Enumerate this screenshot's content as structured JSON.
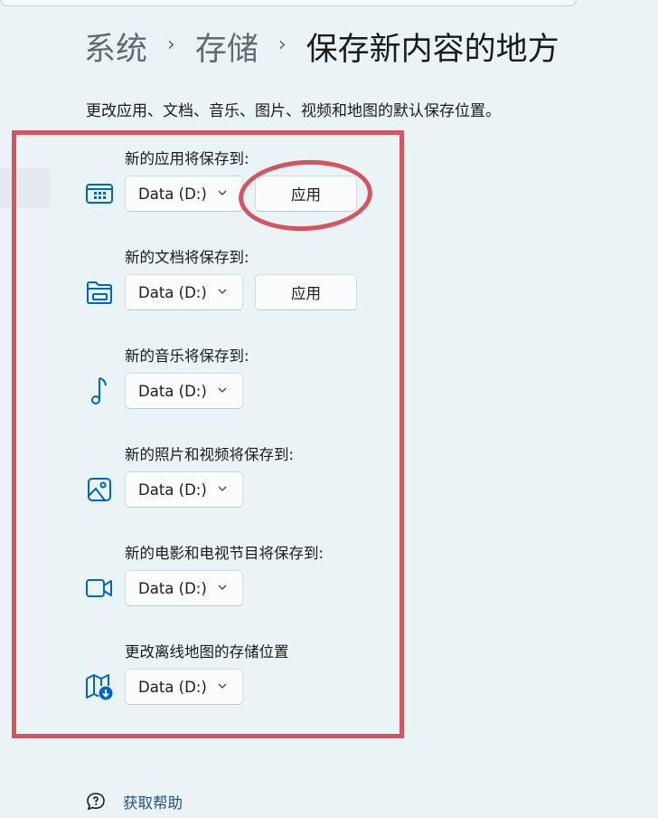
{
  "breadcrumb": {
    "level1": "系统",
    "level2": "存储",
    "current": "保存新内容的地方",
    "separator": "›"
  },
  "description": "更改应用、文档、音乐、图片、视频和地图的默认保存位置。",
  "groups": [
    {
      "label": "新的应用将保存到:",
      "icon": "apps-icon",
      "drive": "Data (D:)",
      "apply": "应用"
    },
    {
      "label": "新的文档将保存到:",
      "icon": "folder-icon",
      "drive": "Data (D:)",
      "apply": "应用"
    },
    {
      "label": "新的音乐将保存到:",
      "icon": "music-note-icon",
      "drive": "Data (D:)"
    },
    {
      "label": "新的照片和视频将保存到:",
      "icon": "image-icon",
      "drive": "Data (D:)"
    },
    {
      "label": "新的电影和电视节目将保存到:",
      "icon": "video-camera-icon",
      "drive": "Data (D:)"
    },
    {
      "label": "更改离线地图的存储位置",
      "icon": "map-download-icon",
      "drive": "Data (D:)"
    }
  ],
  "help": {
    "label": "获取帮助",
    "icon": "help-chat-icon"
  },
  "colors": {
    "background": "#eaf3f6",
    "accent": "#0067c0",
    "annotation": "#d4545f",
    "link": "#1f4f8f"
  }
}
